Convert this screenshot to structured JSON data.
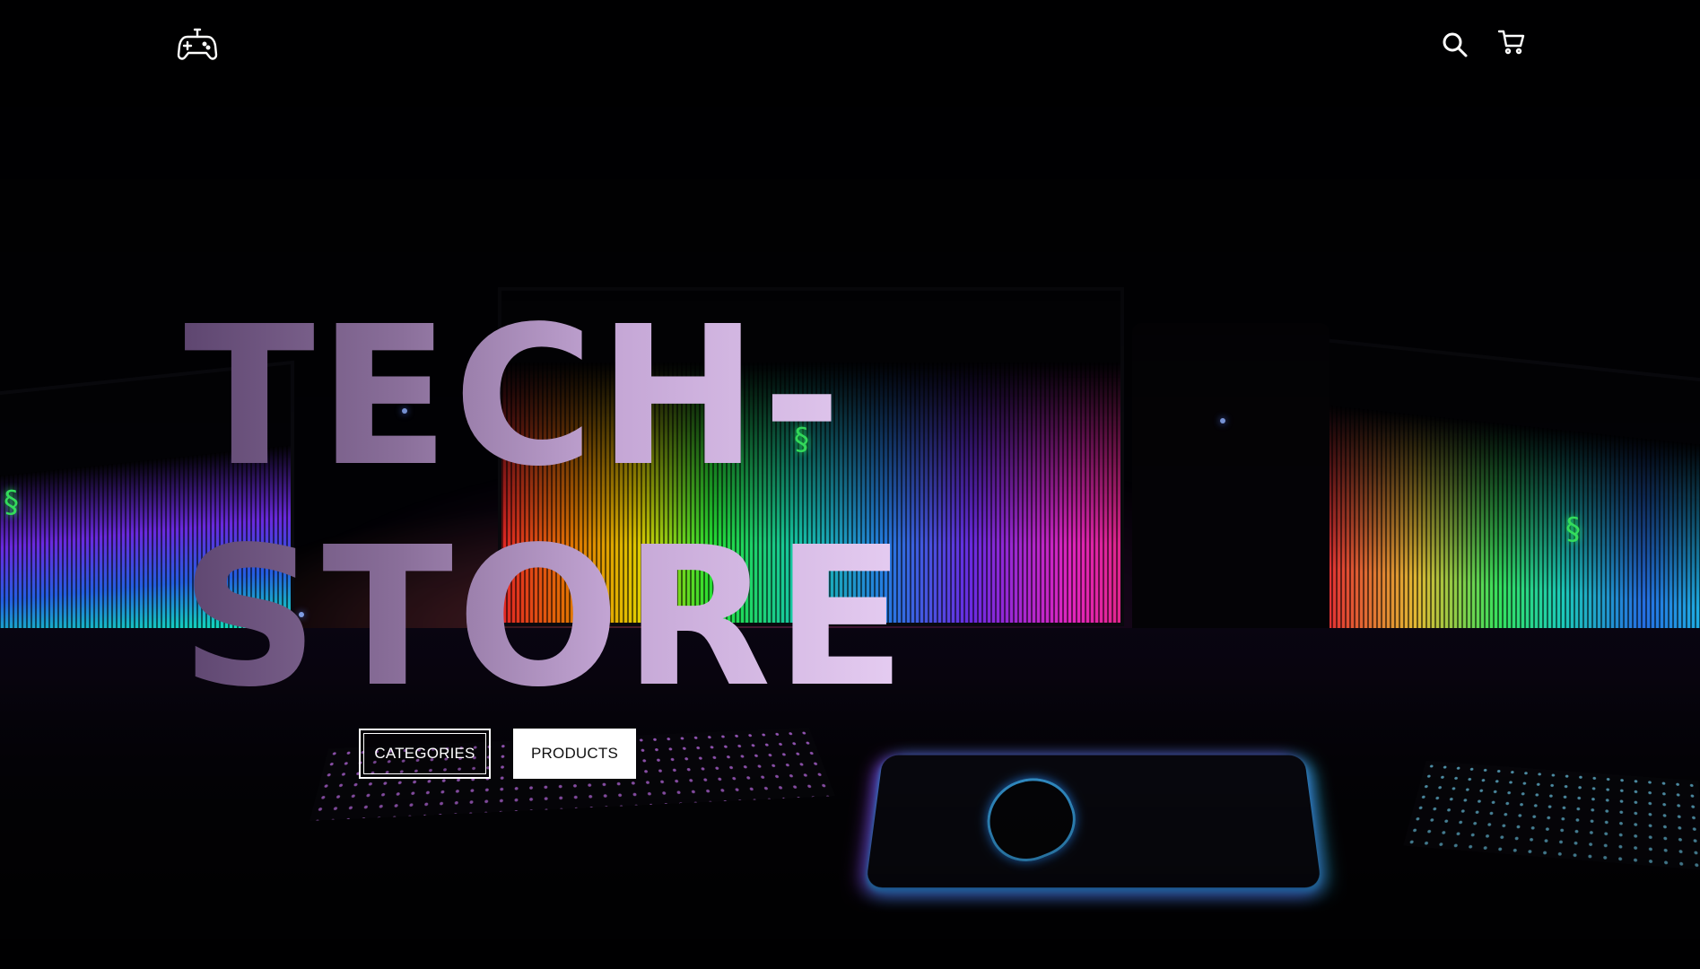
{
  "header": {
    "logo_icon": "gamepad-icon",
    "search_icon": "search-icon",
    "cart_icon": "cart-icon"
  },
  "hero": {
    "title_line1": "TECH-",
    "title_line2": "STORE"
  },
  "buttons": {
    "categories_label": "CATEGORIES",
    "products_label": "PRODUCTS"
  },
  "colors": {
    "header_icon": "#ffffff",
    "button_outline": "#ffffff",
    "button_solid_bg": "#ffffff",
    "button_solid_text": "#111111",
    "title_gradient_start": "#5e4670",
    "title_gradient_end": "#e6cdf2"
  }
}
